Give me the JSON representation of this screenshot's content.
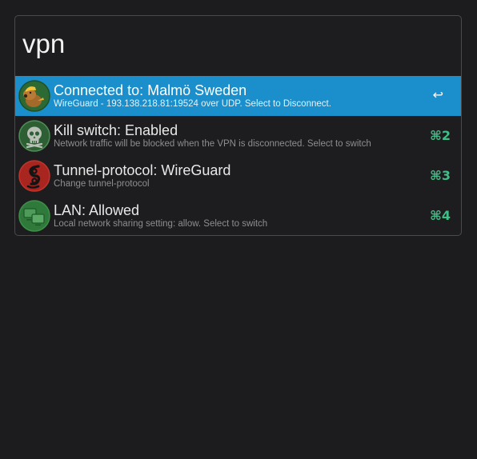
{
  "search": {
    "value": "vpn"
  },
  "colors": {
    "selected_background": "#1b8fcb",
    "shortcut": "#3fbf87"
  },
  "results": [
    {
      "title": "Connected to: Malmö Sweden",
      "subtitle": "WireGuard - 193.138.218.81:19524 over UDP. Select to Disconnect.",
      "shortcut": "↩",
      "icon": "mullvad-mole-icon",
      "selected": true
    },
    {
      "title": "Kill switch: Enabled",
      "subtitle": "Network traffic will be blocked when the VPN is disconnected. Select to switch",
      "shortcut": "⌘2",
      "icon": "skull-icon",
      "selected": false
    },
    {
      "title": "Tunnel-protocol: WireGuard",
      "subtitle": "Change tunnel-protocol",
      "shortcut": "⌘3",
      "icon": "wireguard-icon",
      "selected": false
    },
    {
      "title": "LAN: Allowed",
      "subtitle": "Local network sharing setting: allow. Select to switch",
      "shortcut": "⌘4",
      "icon": "lan-screens-icon",
      "selected": false
    }
  ]
}
